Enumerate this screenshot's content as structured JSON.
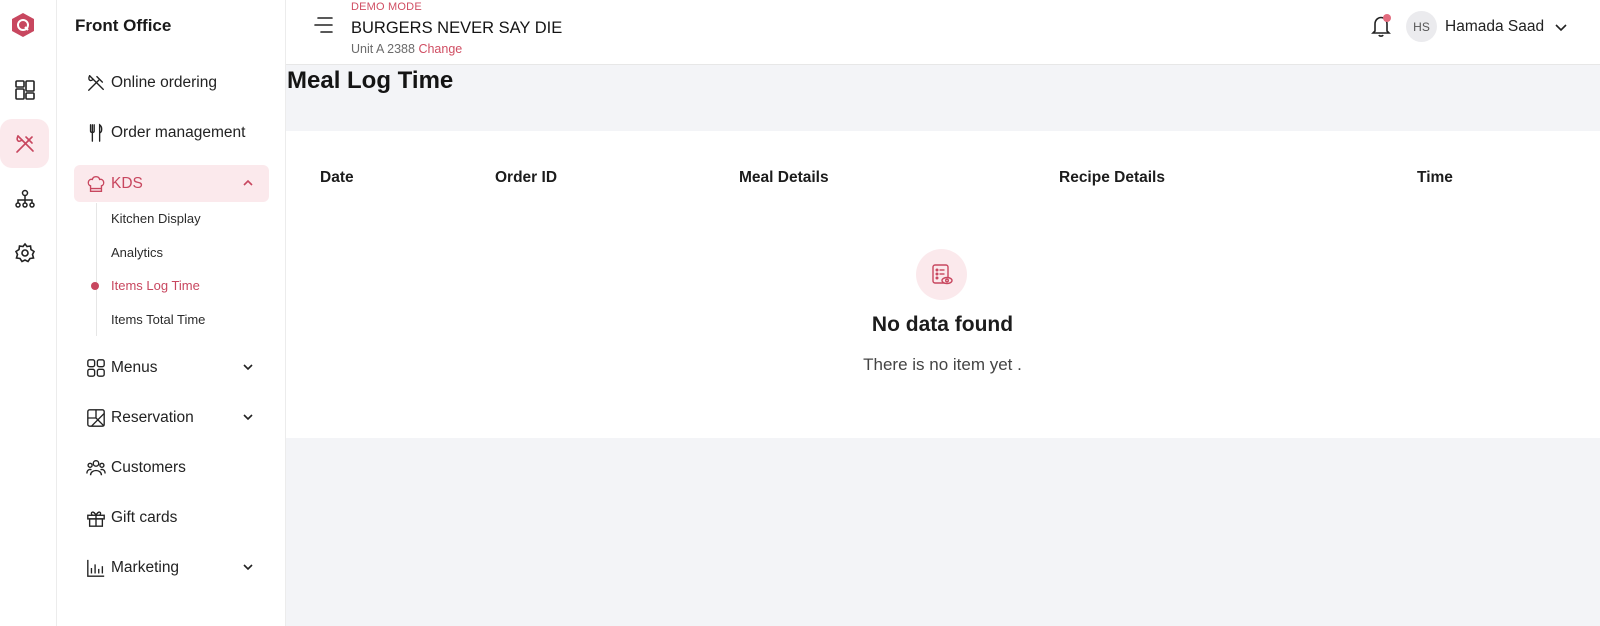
{
  "rail": {
    "icons": [
      "logo-icon",
      "dashboard-icon",
      "utensils-icon",
      "org-chart-icon",
      "settings-icon"
    ]
  },
  "sidebar": {
    "title": "Front Office",
    "items": [
      {
        "label": "Online ordering"
      },
      {
        "label": "Order management"
      },
      {
        "label": "KDS"
      },
      {
        "label": "Menus"
      },
      {
        "label": "Reservation"
      },
      {
        "label": "Customers"
      },
      {
        "label": "Gift cards"
      },
      {
        "label": "Marketing"
      }
    ],
    "kds_sub": [
      {
        "label": "Kitchen Display"
      },
      {
        "label": "Analytics"
      },
      {
        "label": "Items Log Time"
      },
      {
        "label": "Items Total Time"
      }
    ]
  },
  "header": {
    "demo_label": "DEMO MODE",
    "store_name": "BURGERS NEVER SAY DIE",
    "unit": "Unit A 2388",
    "change_label": "Change",
    "avatar_initials": "HS",
    "user_name": "Hamada Saad"
  },
  "main": {
    "title": "Meal Log Time",
    "columns": [
      "Date",
      "Order ID",
      "Meal Details",
      "Recipe Details",
      "Time"
    ],
    "empty_title": "No data found",
    "empty_subtitle": "There is no item yet ."
  },
  "colors": {
    "accent": "#c8475f",
    "accent_bg": "#fbe9ec",
    "page_bg": "#f3f4f7"
  }
}
